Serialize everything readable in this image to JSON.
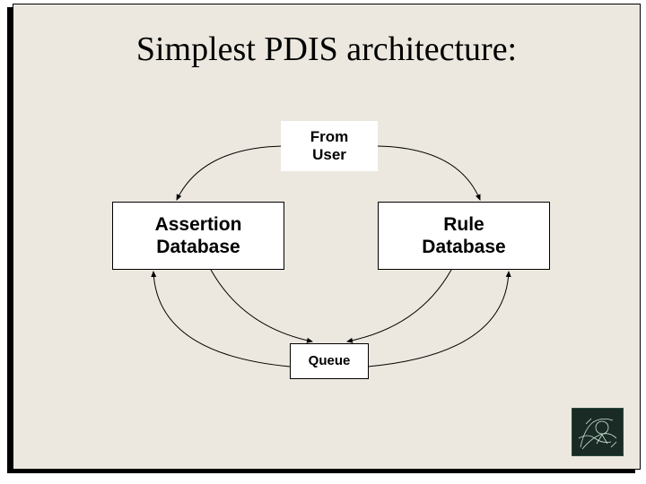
{
  "title": "Simplest PDIS architecture:",
  "nodes": {
    "from_user": "From\nUser",
    "assertion_db": "Assertion\nDatabase",
    "rule_db": "Rule\nDatabase",
    "queue": "Queue"
  },
  "icon": {
    "name": "logo-icon"
  }
}
